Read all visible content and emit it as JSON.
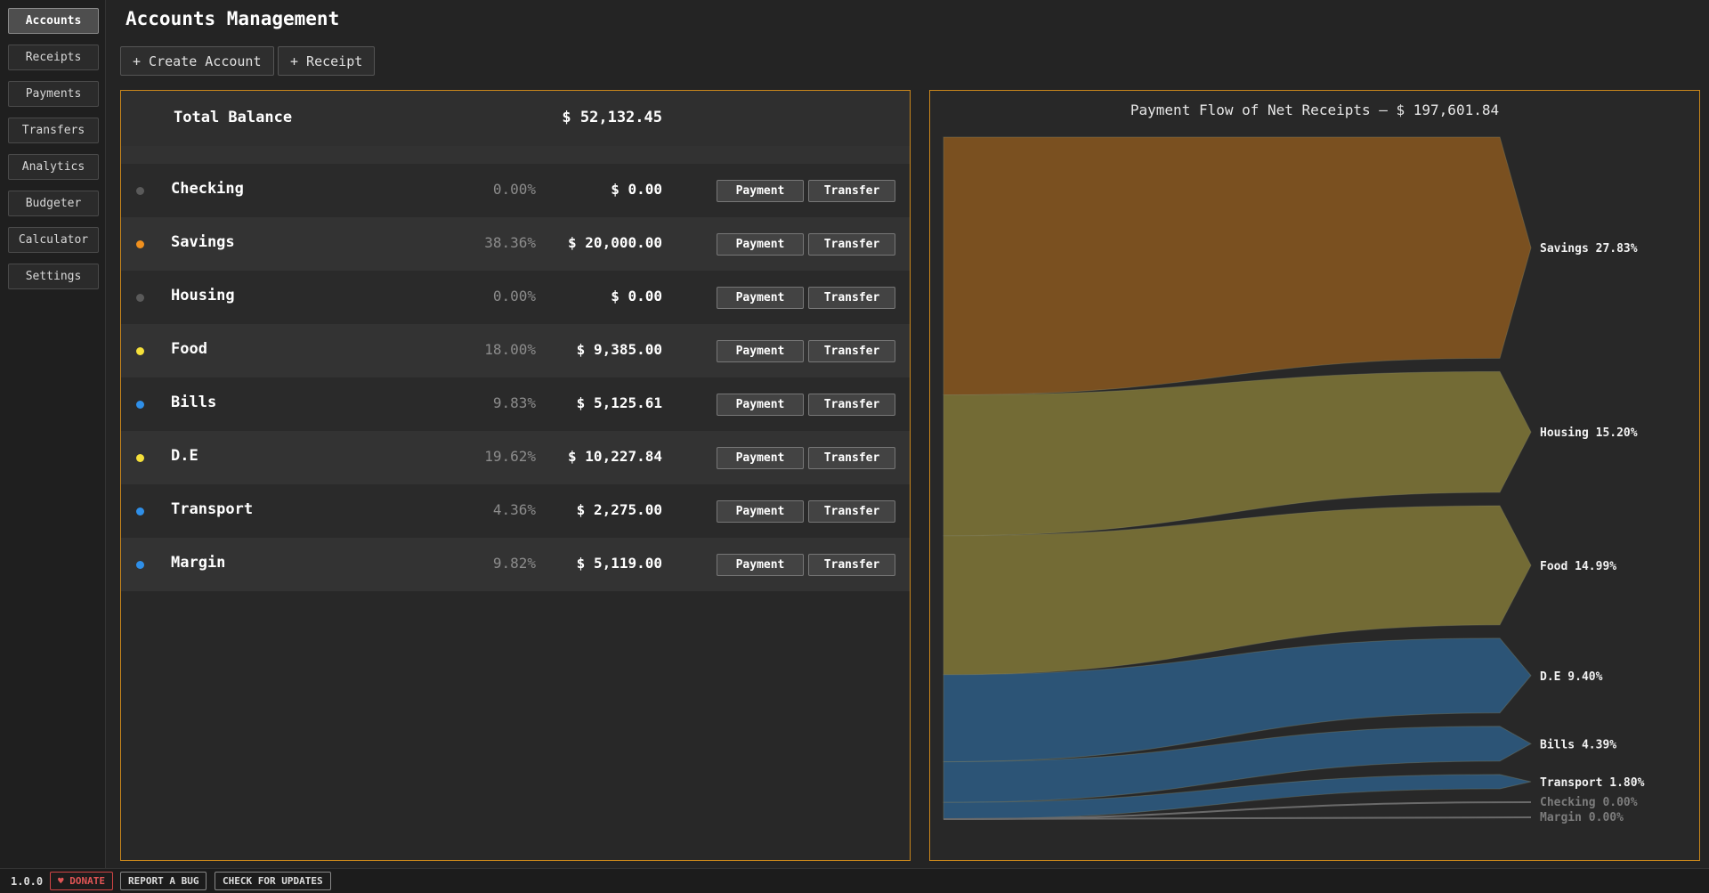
{
  "nav": {
    "items": [
      {
        "label": "Accounts",
        "active": true
      },
      {
        "label": "Receipts"
      },
      {
        "label": "Payments"
      },
      {
        "label": "Transfers"
      },
      {
        "label": "Analytics"
      },
      {
        "label": "Budgeter"
      },
      {
        "label": "Calculator"
      },
      {
        "label": "Settings"
      }
    ]
  },
  "header": {
    "title": "Accounts Management",
    "create_account_label": "+ Create Account",
    "receipt_label": "+ Receipt"
  },
  "accounts": {
    "total_label": "Total Balance",
    "total_value": "$ 52,132.45",
    "payment_label": "Payment",
    "transfer_label": "Transfer",
    "rows": [
      {
        "name": "Checking",
        "pct": "0.00%",
        "value": "$ 0.00",
        "dot_color": "#5a5a5a"
      },
      {
        "name": "Savings",
        "pct": "38.36%",
        "value": "$ 20,000.00",
        "dot_color": "#f0901e"
      },
      {
        "name": "Housing",
        "pct": "0.00%",
        "value": "$ 0.00",
        "dot_color": "#5a5a5a"
      },
      {
        "name": "Food",
        "pct": "18.00%",
        "value": "$ 9,385.00",
        "dot_color": "#f5e03a"
      },
      {
        "name": "Bills",
        "pct": "9.83%",
        "value": "$ 5,125.61",
        "dot_color": "#2f8fe8"
      },
      {
        "name": "D.E",
        "pct": "19.62%",
        "value": "$ 10,227.84",
        "dot_color": "#f5e03a"
      },
      {
        "name": "Transport",
        "pct": "4.36%",
        "value": "$ 2,275.00",
        "dot_color": "#2f8fe8"
      },
      {
        "name": "Margin",
        "pct": "9.82%",
        "value": "$ 5,119.00",
        "dot_color": "#2f8fe8"
      }
    ]
  },
  "flow": {
    "title": "Payment Flow of Net Receipts — $ 197,601.84",
    "colors": {
      "orange": "#7a5020",
      "olive": "#736b35",
      "blue": "#2c5476",
      "zero": "#6a6a6a"
    },
    "items": [
      {
        "label": "Savings 27.83%",
        "share": 27.83,
        "color": "orange"
      },
      {
        "label": "Housing 15.20%",
        "share": 15.2,
        "color": "olive"
      },
      {
        "label": "Food 14.99%",
        "share": 14.99,
        "color": "olive"
      },
      {
        "label": "D.E 9.40%",
        "share": 9.4,
        "color": "blue"
      },
      {
        "label": "Bills 4.39%",
        "share": 4.39,
        "color": "blue"
      },
      {
        "label": "Transport 1.80%",
        "share": 1.8,
        "color": "blue"
      },
      {
        "label": "Checking 0.00%",
        "share": 0,
        "color": "zero"
      },
      {
        "label": "Margin 0.00%",
        "share": 0,
        "color": "zero"
      }
    ]
  },
  "footer": {
    "version": "1.0.0",
    "donate_label": "♥ DONATE",
    "report_label": "REPORT A BUG",
    "updates_label": "CHECK FOR UPDATES"
  }
}
